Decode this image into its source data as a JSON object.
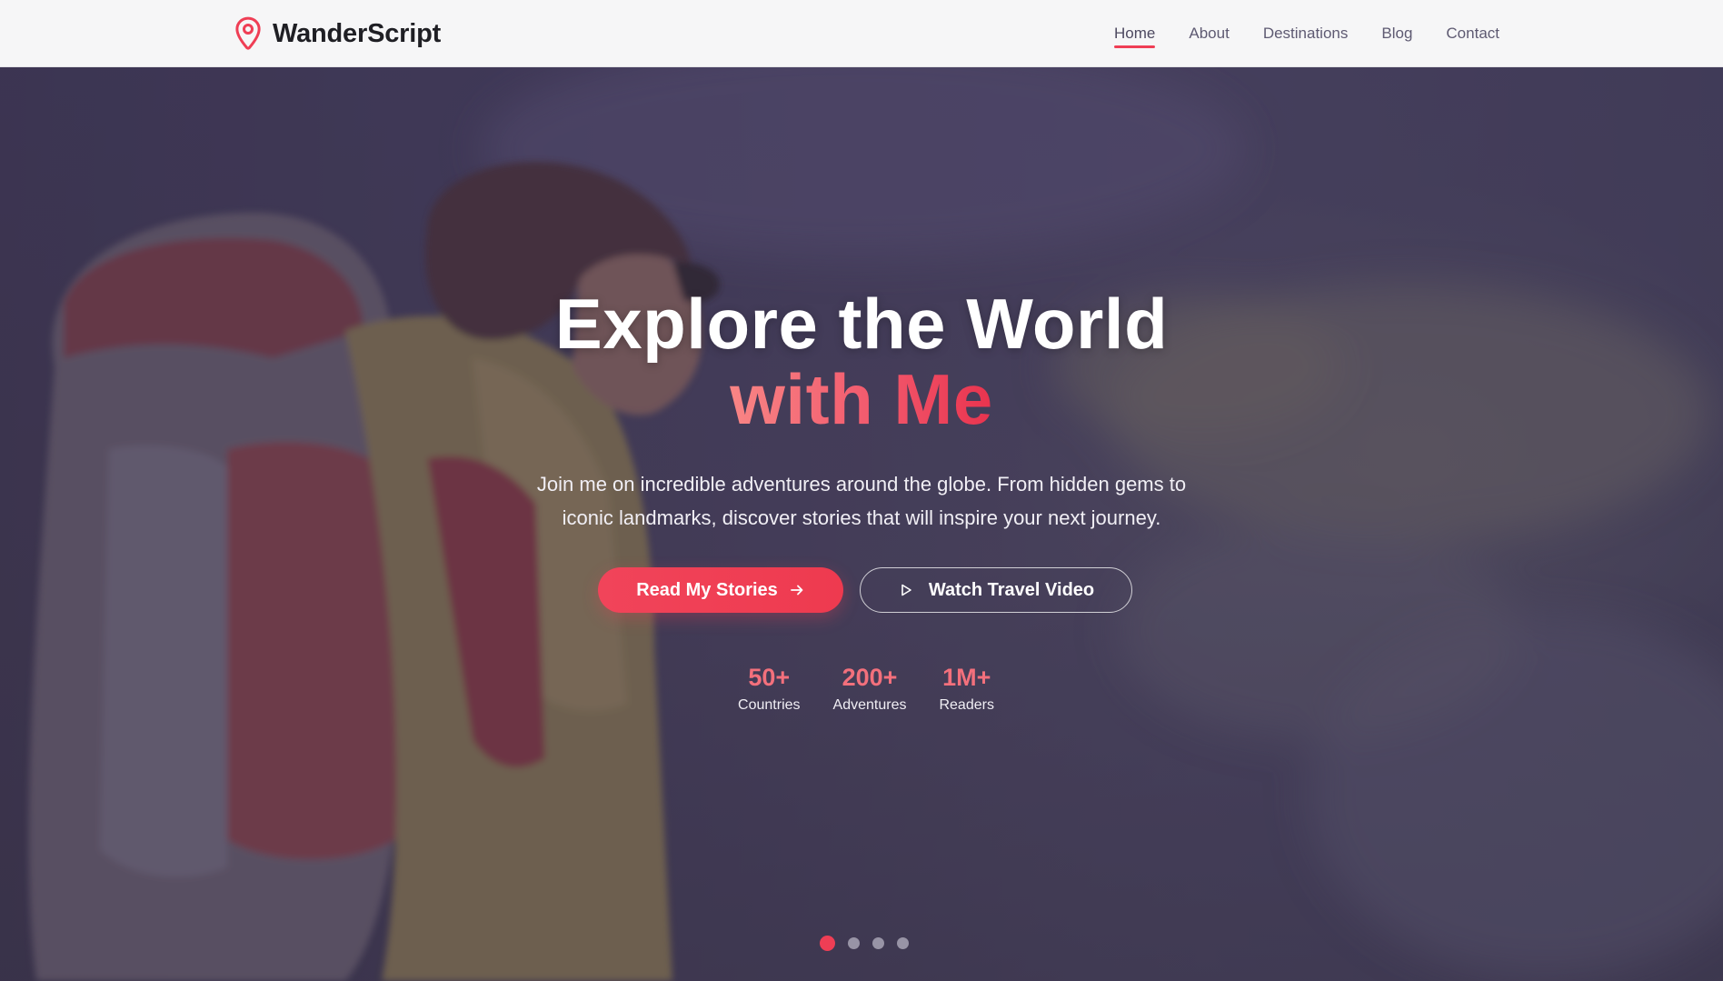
{
  "brand": {
    "name": "WanderScript",
    "icon": "map-pin-icon",
    "accent_color": "#ef3e55"
  },
  "nav": {
    "items": [
      {
        "label": "Home",
        "active": true
      },
      {
        "label": "About",
        "active": false
      },
      {
        "label": "Destinations",
        "active": false
      },
      {
        "label": "Blog",
        "active": false
      },
      {
        "label": "Contact",
        "active": false
      }
    ]
  },
  "hero": {
    "title_line1": "Explore the World",
    "title_line2": "with Me",
    "subtitle": "Join me on incredible adventures around the globe. From hidden gems to iconic landmarks, discover stories that will inspire your next journey.",
    "primary_button": {
      "label": "Read My Stories",
      "icon": "arrow-right-icon"
    },
    "secondary_button": {
      "label": "Watch Travel Video",
      "icon": "play-icon"
    },
    "stats": [
      {
        "value": "50+",
        "label": "Countries"
      },
      {
        "value": "200+",
        "label": "Adventures"
      },
      {
        "value": "1M+",
        "label": "Readers"
      }
    ],
    "slides": {
      "count": 4,
      "active_index": 0
    }
  }
}
